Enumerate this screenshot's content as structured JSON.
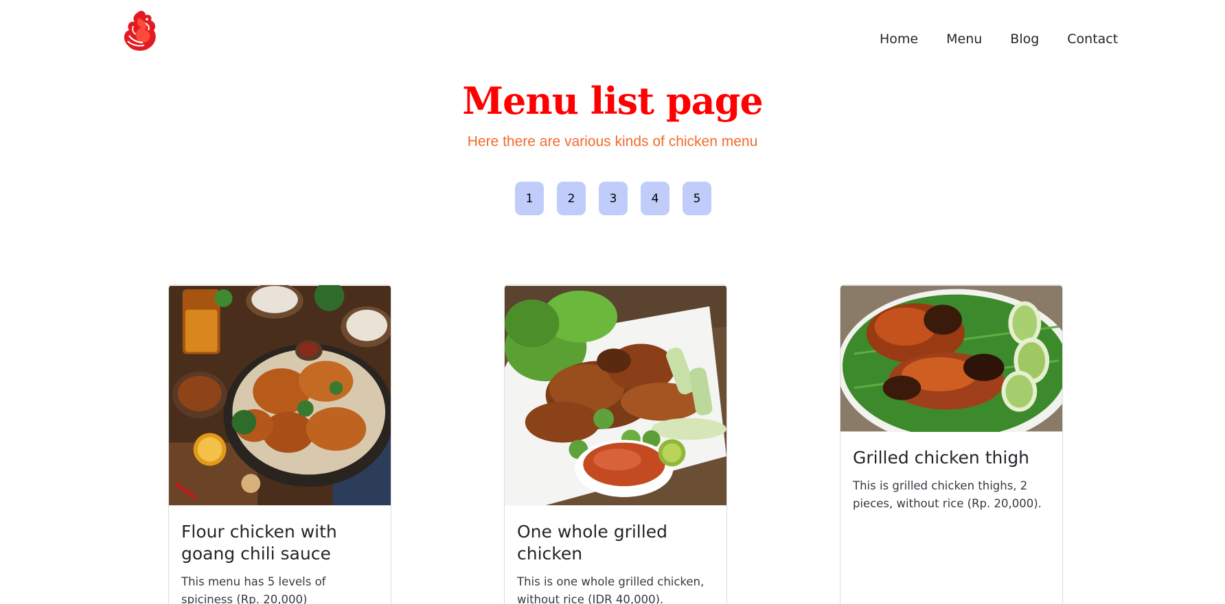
{
  "nav": {
    "logo": "flame-rooster-logo",
    "links": [
      "Home",
      "Menu",
      "Blog",
      "Contact"
    ]
  },
  "header": {
    "title": "Menu list page",
    "subtitle": "Here there are various kinds of chicken menu"
  },
  "pagination": {
    "pages": [
      "1",
      "2",
      "3",
      "4",
      "5"
    ]
  },
  "cards": [
    {
      "title": "Flour chicken with goang chili sauce",
      "text": "This menu has 5 levels of spiciness (Rp. 20,000)"
    },
    {
      "title": "One whole grilled chicken",
      "text": "This is one whole grilled chicken, without rice (IDR 40,000)."
    },
    {
      "title": "Grilled chicken thigh",
      "text": "This is grilled chicken thighs, 2 pieces, without rice (Rp. 20,000)."
    }
  ],
  "colors": {
    "title": "#ff0000",
    "subtitle": "#f26a2a",
    "page_button": "#c0cdfb"
  }
}
